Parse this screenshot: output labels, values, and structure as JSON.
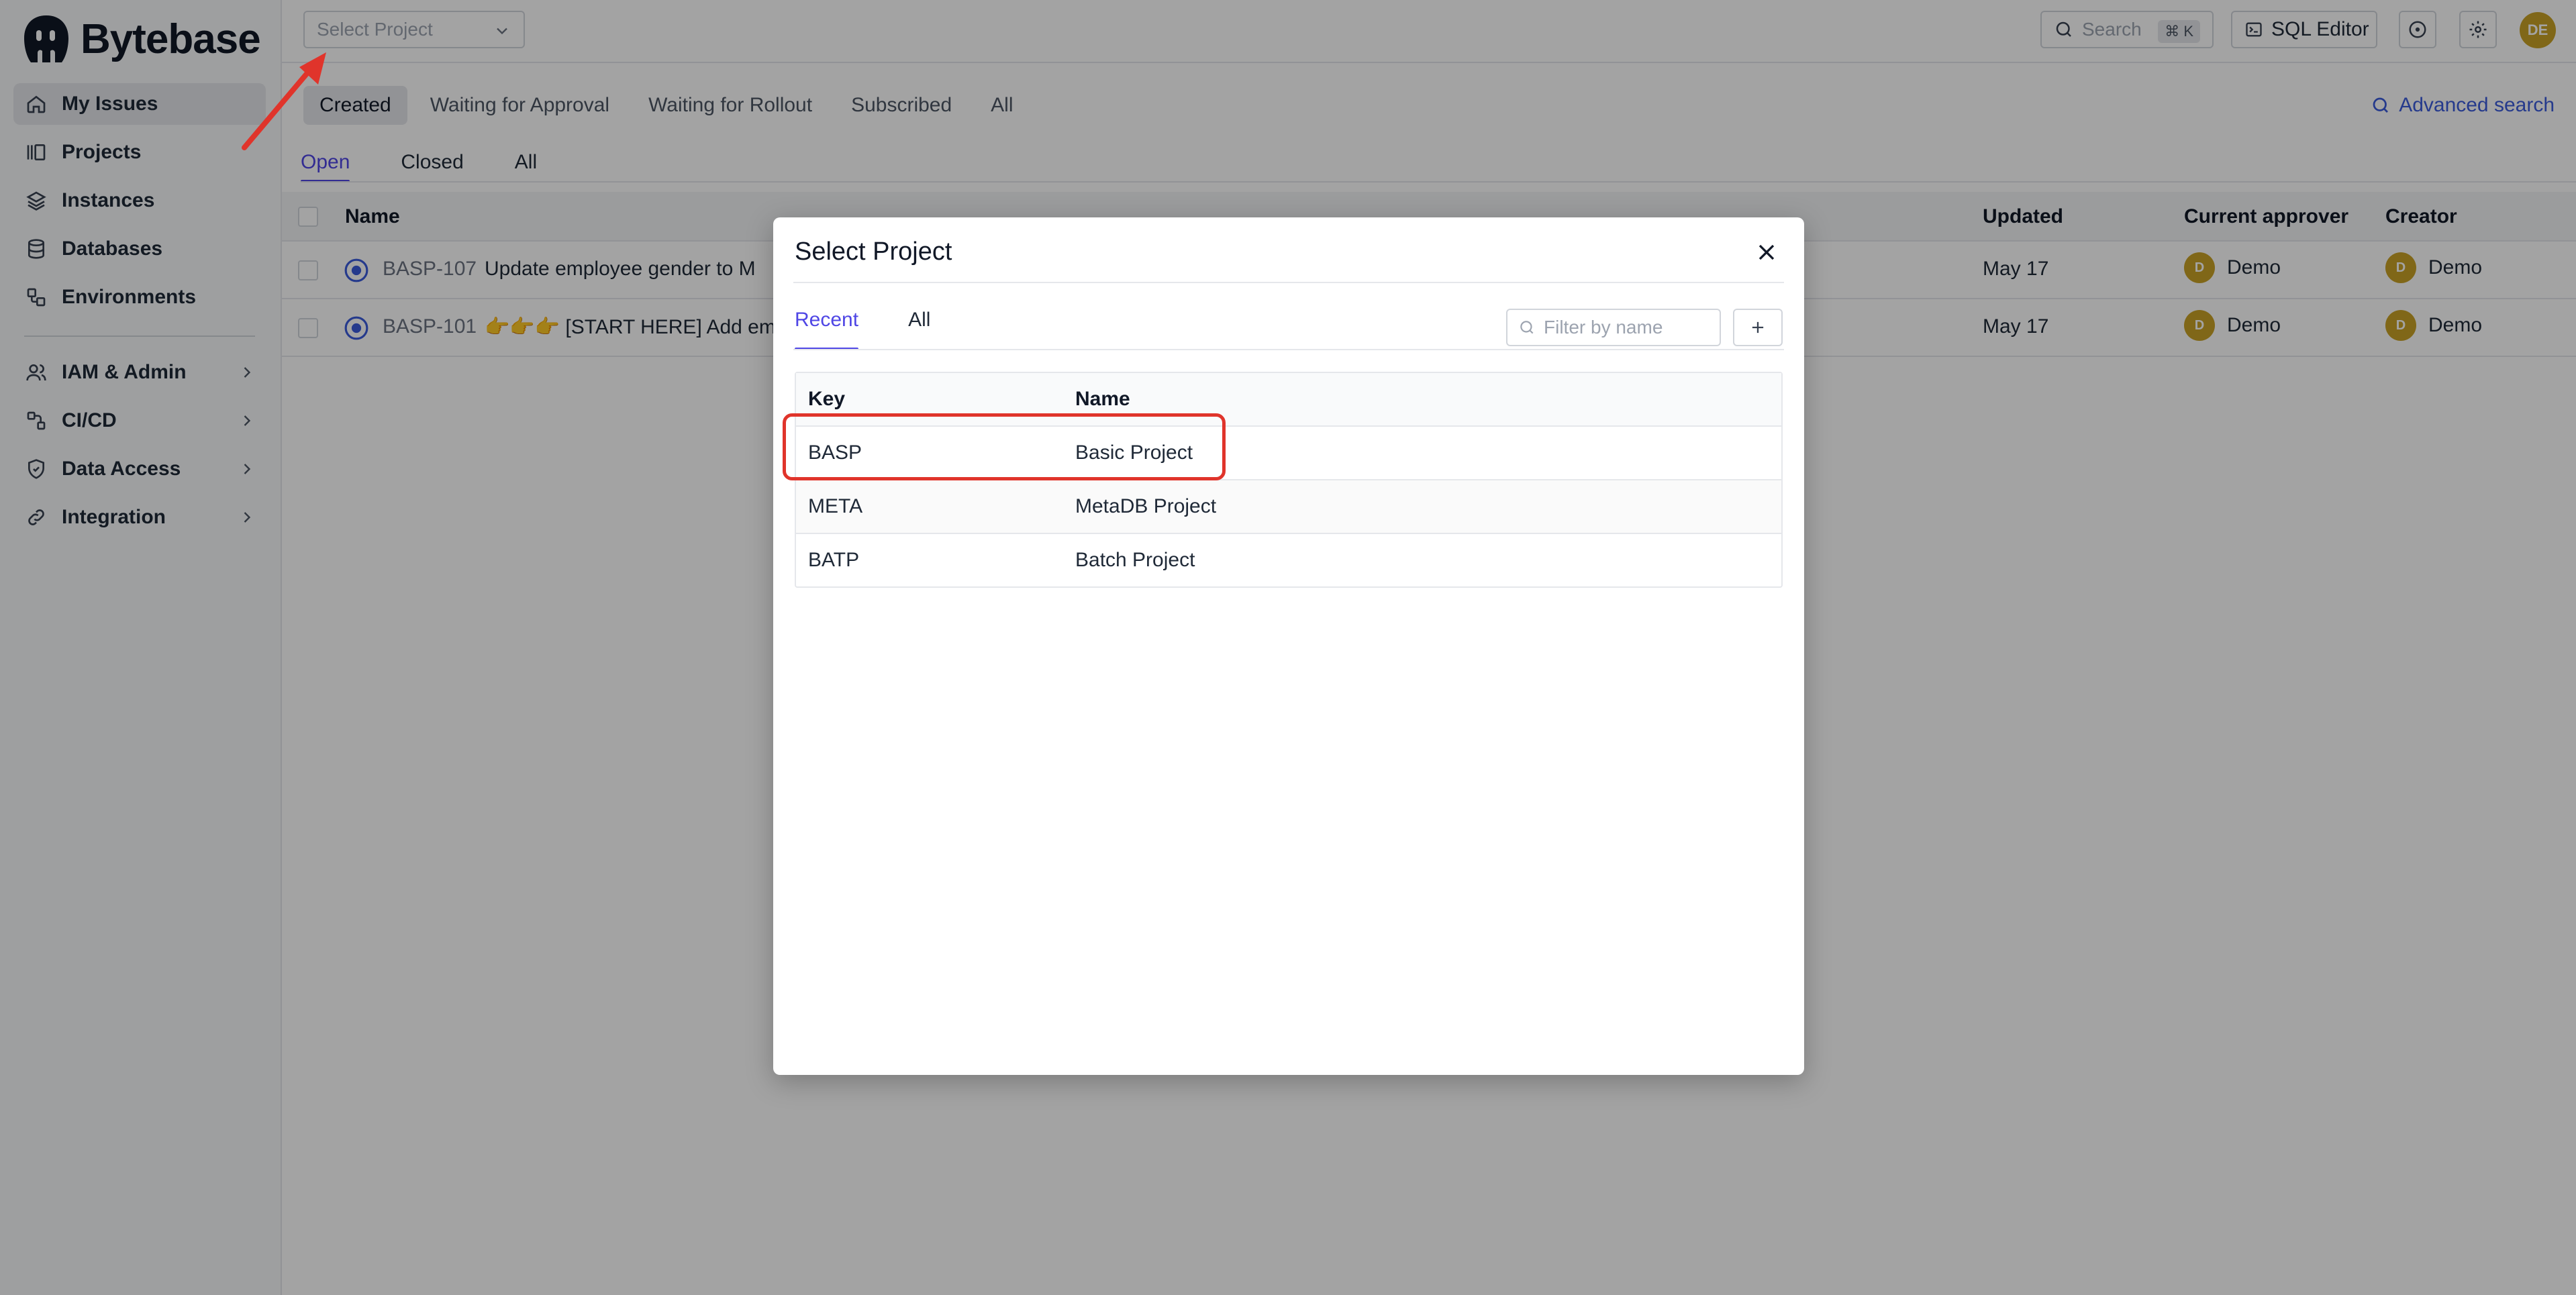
{
  "brand": {
    "name": "Bytebase"
  },
  "sidebar": {
    "items": [
      {
        "label": "My Issues",
        "icon": "home-icon",
        "active": true
      },
      {
        "label": "Projects",
        "icon": "projects-icon"
      },
      {
        "label": "Instances",
        "icon": "layers-icon"
      },
      {
        "label": "Databases",
        "icon": "database-icon"
      },
      {
        "label": "Environments",
        "icon": "environments-icon"
      }
    ],
    "groups": [
      {
        "label": "IAM & Admin",
        "icon": "users-icon"
      },
      {
        "label": "CI/CD",
        "icon": "workflow-icon"
      },
      {
        "label": "Data Access",
        "icon": "shield-icon"
      },
      {
        "label": "Integration",
        "icon": "link-icon"
      }
    ]
  },
  "header": {
    "project_select_placeholder": "Select Project",
    "search_placeholder": "Search",
    "search_shortcut": "⌘ K",
    "sql_editor_label": "SQL Editor",
    "user_initials": "DE"
  },
  "main": {
    "filter_tabs": [
      "Created",
      "Waiting for Approval",
      "Waiting for Rollout",
      "Subscribed",
      "All"
    ],
    "advanced_search": "Advanced search",
    "status_tabs": [
      "Open",
      "Closed",
      "All"
    ],
    "columns": {
      "name": "Name",
      "updated": "Updated",
      "current_approver": "Current approver",
      "creator": "Creator"
    },
    "issues": [
      {
        "key": "BASP-107",
        "title": "Update employee gender to M",
        "updated": "May 17",
        "approver": "Demo",
        "approver_initial": "D",
        "creator": "Demo",
        "creator_initial": "D"
      },
      {
        "key": "BASP-101",
        "title": "👉👉👉 [START HERE] Add email c",
        "updated": "May 17",
        "approver": "Demo",
        "approver_initial": "D",
        "creator": "Demo",
        "creator_initial": "D"
      }
    ]
  },
  "modal": {
    "title": "Select Project",
    "tabs": [
      "Recent",
      "All"
    ],
    "filter_placeholder": "Filter by name",
    "columns": {
      "key": "Key",
      "name": "Name"
    },
    "projects": [
      {
        "key": "BASP",
        "name": "Basic Project"
      },
      {
        "key": "META",
        "name": "MetaDB Project"
      },
      {
        "key": "BATP",
        "name": "Batch Project"
      }
    ]
  },
  "colors": {
    "accent": "#4f46e5",
    "link": "#3b5bdb",
    "avatar": "#c9a227",
    "annotation": "#e0342b"
  }
}
